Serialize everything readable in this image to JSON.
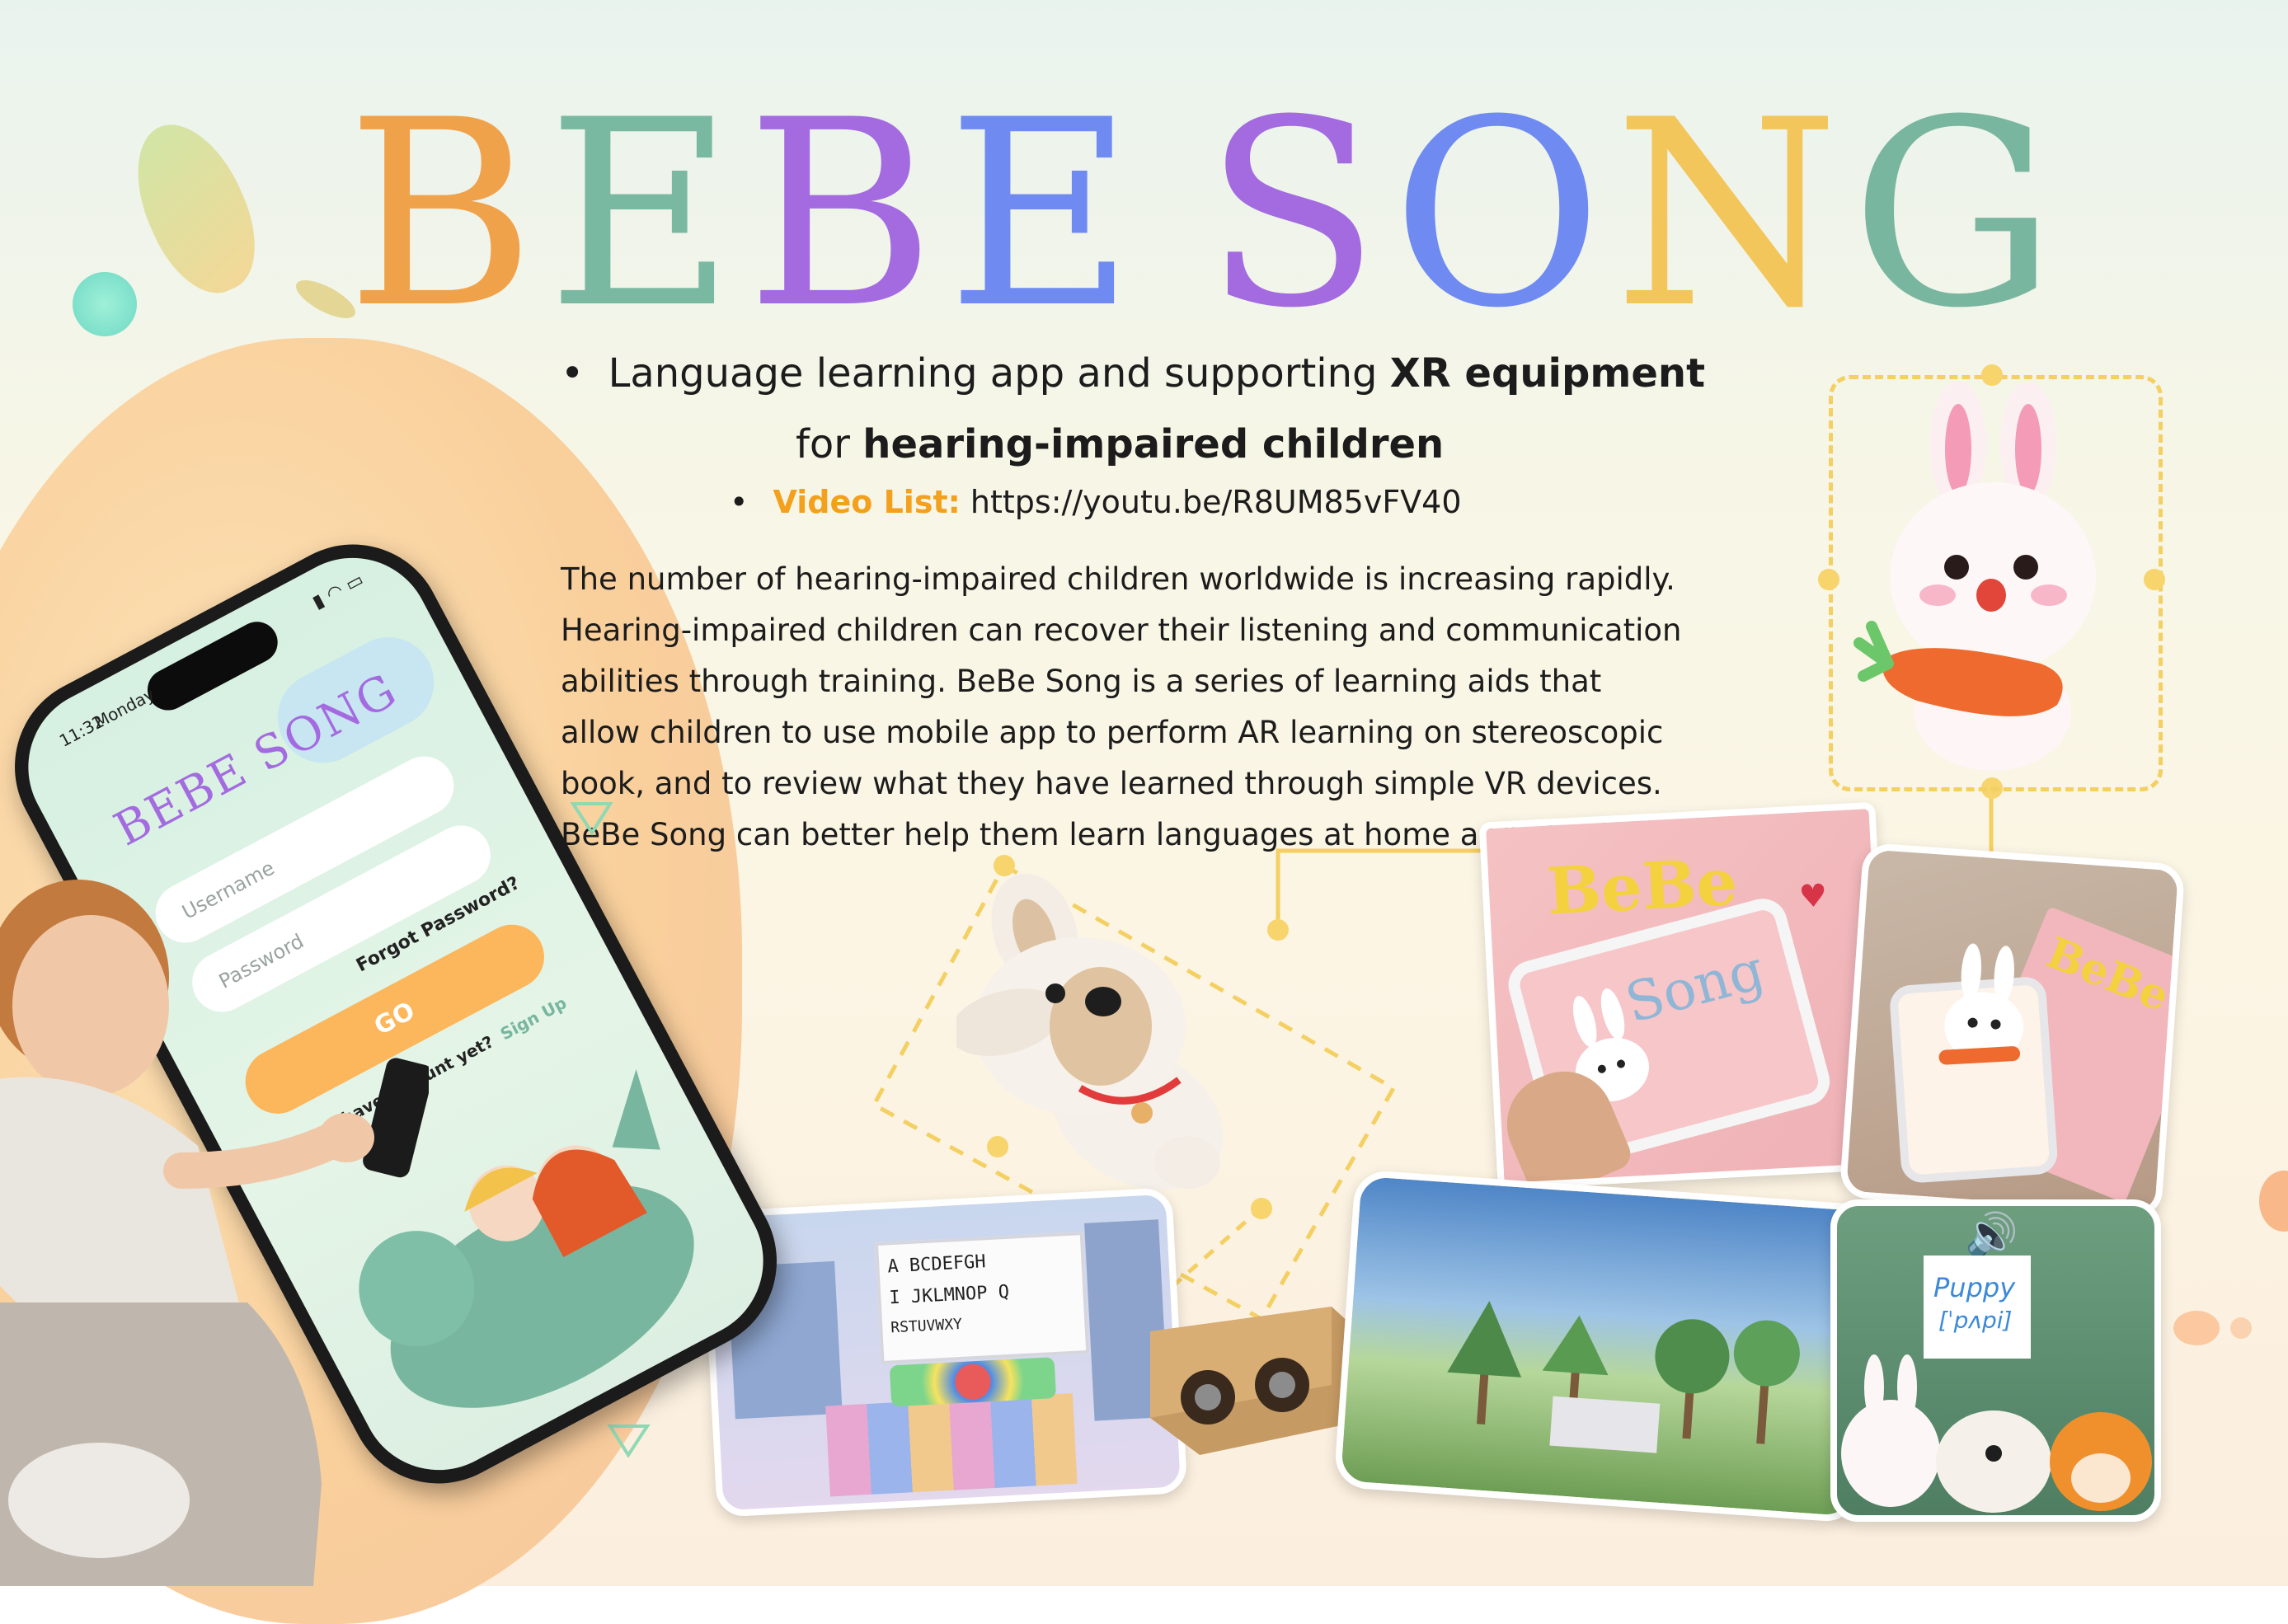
{
  "title": {
    "letters": [
      {
        "ch": "B",
        "color": "#f0a24a"
      },
      {
        "ch": "E",
        "color": "#7ab9a1"
      },
      {
        "ch": "B",
        "color": "#a46be0"
      },
      {
        "ch": "E",
        "color": "#6f8bf2"
      },
      {
        "ch": " ",
        "color": "#000000"
      },
      {
        "ch": "S",
        "color": "#a46be0"
      },
      {
        "ch": "O",
        "color": "#6f8bf2"
      },
      {
        "ch": "N",
        "color": "#f2c65b"
      },
      {
        "ch": "G",
        "color": "#79b6a0"
      }
    ]
  },
  "intro": {
    "bullet": "•",
    "line1_prefix": "Language learning app and supporting ",
    "line1_bold": "XR equipment",
    "line2_prefix": "for ",
    "line2_bold": "hearing-impaired children",
    "video_label": "Video List:",
    "video_url": "https://youtu.be/R8UM85vFV40"
  },
  "paragraph": "The number of hearing-impaired children worldwide is increasing rapidly. Hearing-impaired children can recover their listening and communication abilities through training. BeBe Song is a series of learning aids that allow children to use mobile app to perform AR learning on stereoscopic book, and to review what they have learned through simple VR devices. BeBe Song can better help them learn languages at home and at school.",
  "phone": {
    "time": "11:32",
    "day": "Monday",
    "app_title": "BEBE SONG",
    "username_placeholder": "Username",
    "password_placeholder": "Password",
    "forgot_label": "Forgot Password?",
    "go_label": "GO",
    "no_account_label": "Don't have account yet?",
    "signup_label": "Sign Up"
  },
  "book": {
    "title_part1": "BeBe",
    "title_part2": "Song"
  },
  "ar_book": {
    "title": "BeBe"
  },
  "vr_room": {
    "board_lines": [
      "A BCDEFGH",
      "I JKLMNOP Q",
      "RSTUVWXY"
    ]
  },
  "flashcard": {
    "word": "Puppy",
    "phonetic": "[ˈpʌpi]"
  },
  "colors": {
    "accent_orange": "#f3a01c",
    "dashed_yellow": "#f4cf62",
    "app_green": "#79b6a0",
    "button_orange": "#fcb75c"
  }
}
